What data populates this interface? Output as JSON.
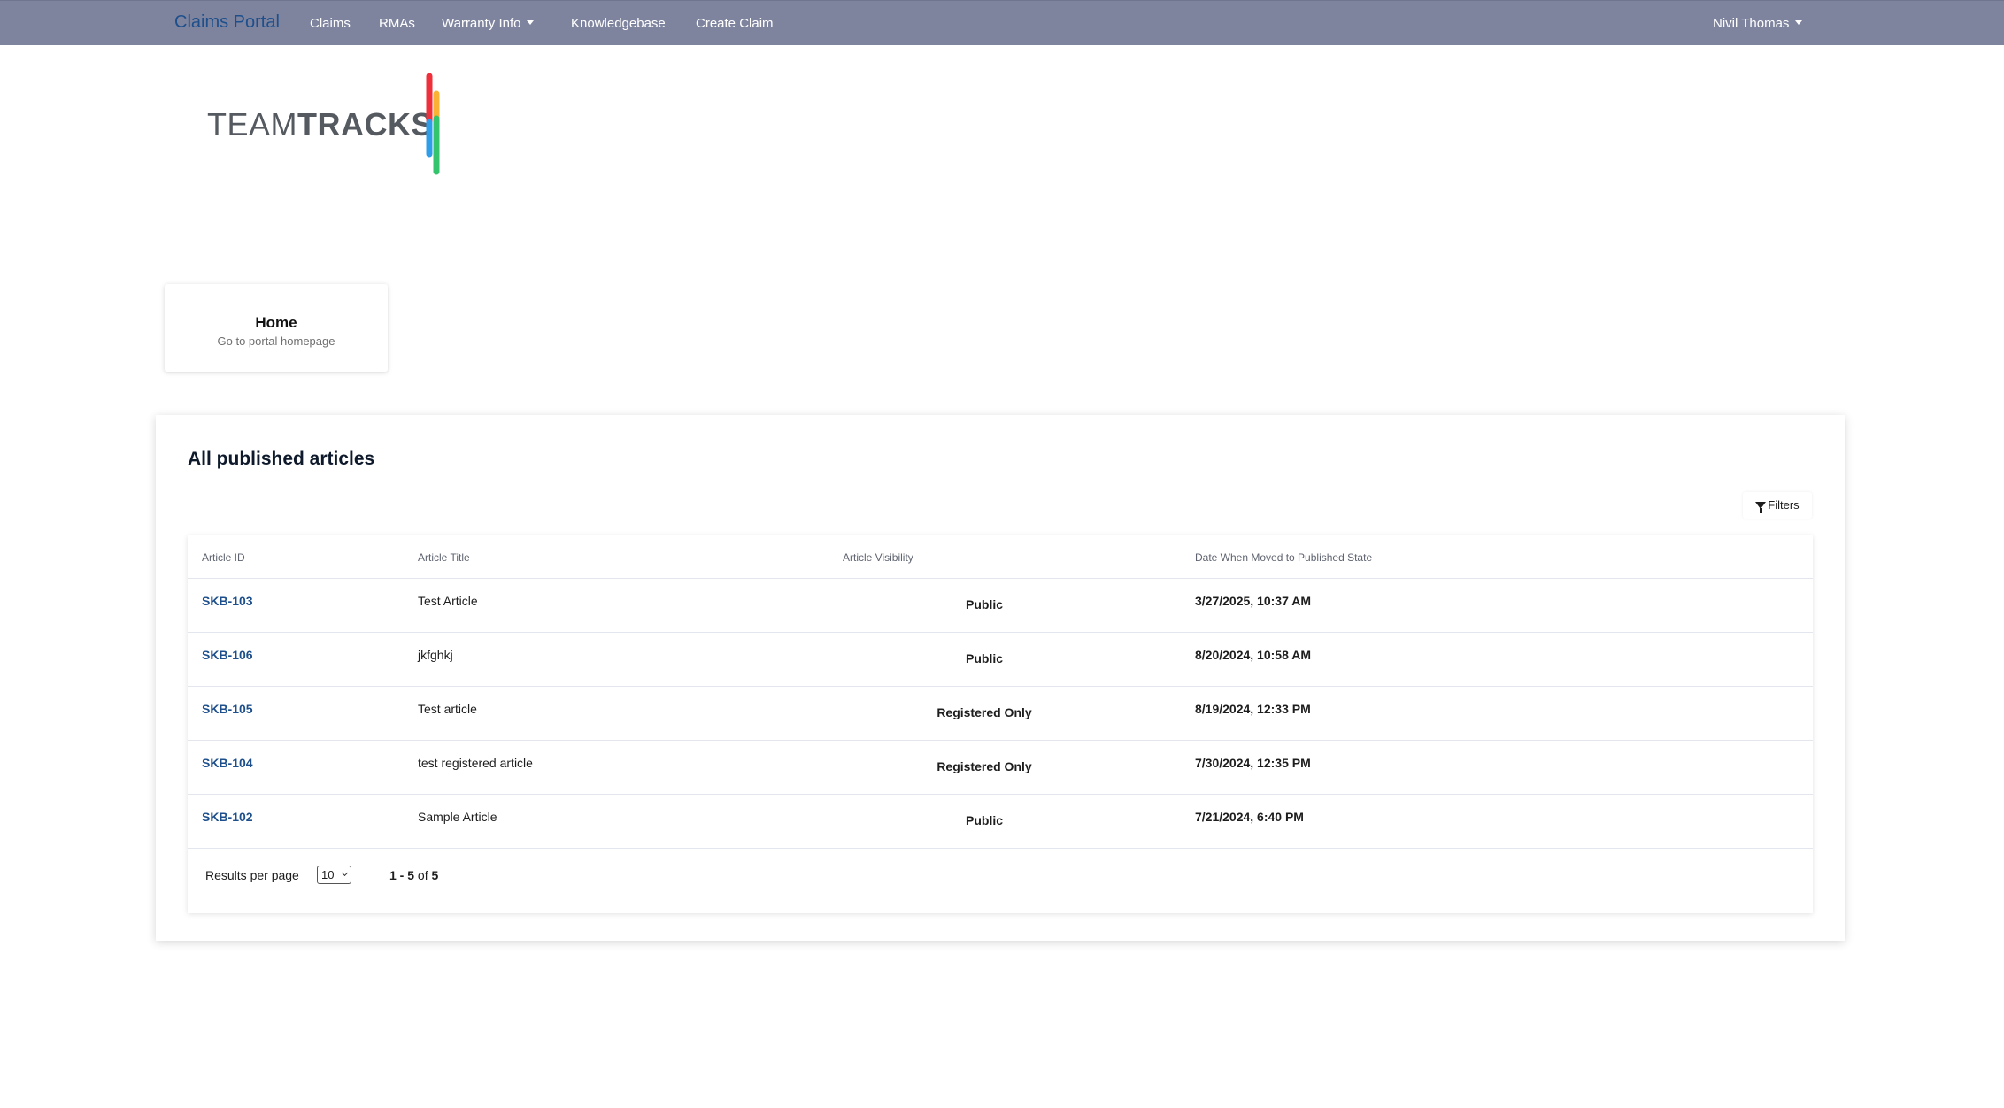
{
  "nav": {
    "brand": "Claims Portal",
    "items": [
      {
        "label": "Claims"
      },
      {
        "label": "RMAs"
      },
      {
        "label": "Warranty Info"
      },
      {
        "label": "Knowledgebase"
      },
      {
        "label": "Create Claim"
      }
    ],
    "user": "Nivil Thomas"
  },
  "logo": {
    "part1": "TEAM",
    "part2": "TRACKS",
    "colors": [
      "#ef2f39",
      "#f9b233",
      "#2f9ee8",
      "#35c46e"
    ]
  },
  "home_card": {
    "title": "Home",
    "subtitle": "Go to portal homepage"
  },
  "articles": {
    "heading": "All published articles",
    "filters_label": "Filters",
    "columns": {
      "id": "Article ID",
      "title": "Article Title",
      "visibility": "Article Visibility",
      "date": "Date When Moved to Published State"
    },
    "rows": [
      {
        "id": "SKB-103",
        "title": "Test Article",
        "visibility": "Public",
        "date": "3/27/2025, 10:37 AM"
      },
      {
        "id": "SKB-106",
        "title": "jkfghkj",
        "visibility": "Public",
        "date": "8/20/2024, 10:58 AM"
      },
      {
        "id": "SKB-105",
        "title": "Test article",
        "visibility": "Registered Only",
        "date": "8/19/2024, 12:33 PM"
      },
      {
        "id": "SKB-104",
        "title": "test registered article",
        "visibility": "Registered Only",
        "date": "7/30/2024, 12:35 PM"
      },
      {
        "id": "SKB-102",
        "title": "Sample Article",
        "visibility": "Public",
        "date": "7/21/2024, 6:40 PM"
      }
    ],
    "pagination": {
      "label": "Results per page",
      "per_page": "10",
      "range": "1 - 5",
      "of": "of",
      "total": "5"
    }
  },
  "colors": {
    "navbar": "#7f849e",
    "brand": "#1d4f8c",
    "link": "#1d4f8c"
  }
}
